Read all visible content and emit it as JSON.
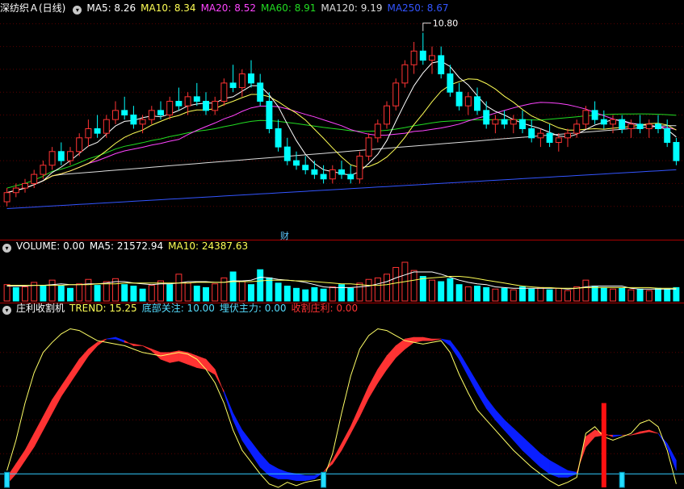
{
  "price_panel": {
    "title": "深纺织Ａ(日线)",
    "ma": [
      {
        "label": "MA5: 8.26",
        "color": "#ffffff"
      },
      {
        "label": "MA10: 8.34",
        "color": "#ffff55"
      },
      {
        "label": "MA20: 8.52",
        "color": "#ff44ff"
      },
      {
        "label": "MA60: 8.91",
        "color": "#22dd22"
      },
      {
        "label": "MA120: 9.19",
        "color": "#dddddd"
      },
      {
        "label": "MA250: 8.67",
        "color": "#3355ff"
      }
    ],
    "high_marker": "10.80",
    "event_marker": "财"
  },
  "volume_panel": {
    "items": [
      {
        "label": "VOLUME: 0.00",
        "color": "#ffffff"
      },
      {
        "label": "MA5: 21572.94",
        "color": "#ffffff"
      },
      {
        "label": "MA10: 24387.63",
        "color": "#ffff55"
      }
    ]
  },
  "indicator_panel": {
    "items": [
      {
        "label": "庄利收割机",
        "color": "#ffffff"
      },
      {
        "label": "TREND: 15.25",
        "color": "#ffff55"
      },
      {
        "label": "底部关注: 10.00",
        "color": "#55ddff"
      },
      {
        "label": "埋伏主力: 0.00",
        "color": "#55ddff"
      },
      {
        "label": "收割庄利: 0.00",
        "color": "#ff3333"
      }
    ]
  },
  "chart_data": [
    {
      "type": "candlestick",
      "ylim": [
        6.5,
        11.2
      ],
      "up_color": "#ff3333",
      "down_color": "#00ffff",
      "candles": [
        [
          7.1,
          7.4,
          7.0,
          7.3
        ],
        [
          7.3,
          7.5,
          7.2,
          7.4
        ],
        [
          7.4,
          7.6,
          7.3,
          7.5
        ],
        [
          7.5,
          7.8,
          7.4,
          7.7
        ],
        [
          7.7,
          8.0,
          7.6,
          7.9
        ],
        [
          7.9,
          8.3,
          7.8,
          8.2
        ],
        [
          8.2,
          8.4,
          7.9,
          8.0
        ],
        [
          8.0,
          8.3,
          7.9,
          8.2
        ],
        [
          8.2,
          8.6,
          8.1,
          8.5
        ],
        [
          8.5,
          8.9,
          8.3,
          8.7
        ],
        [
          8.7,
          9.0,
          8.5,
          8.6
        ],
        [
          8.6,
          9.0,
          8.5,
          8.9
        ],
        [
          8.9,
          9.3,
          8.8,
          9.1
        ],
        [
          9.1,
          9.4,
          8.9,
          9.0
        ],
        [
          9.0,
          9.2,
          8.7,
          8.8
        ],
        [
          8.8,
          9.0,
          8.6,
          8.9
        ],
        [
          8.9,
          9.2,
          8.8,
          9.1
        ],
        [
          9.1,
          9.3,
          8.9,
          9.0
        ],
        [
          9.0,
          9.4,
          8.9,
          9.3
        ],
        [
          9.3,
          9.6,
          9.1,
          9.2
        ],
        [
          9.2,
          9.5,
          9.0,
          9.4
        ],
        [
          9.4,
          9.7,
          9.2,
          9.3
        ],
        [
          9.3,
          9.5,
          9.0,
          9.1
        ],
        [
          9.1,
          9.4,
          9.0,
          9.3
        ],
        [
          9.3,
          9.8,
          9.2,
          9.7
        ],
        [
          9.7,
          10.1,
          9.5,
          9.6
        ],
        [
          9.6,
          10.0,
          9.4,
          9.9
        ],
        [
          9.9,
          10.2,
          9.6,
          9.7
        ],
        [
          9.7,
          9.9,
          9.2,
          9.3
        ],
        [
          9.3,
          9.5,
          8.6,
          8.7
        ],
        [
          8.7,
          8.9,
          8.2,
          8.3
        ],
        [
          8.3,
          8.5,
          7.9,
          8.0
        ],
        [
          8.0,
          8.2,
          7.8,
          7.9
        ],
        [
          7.9,
          8.1,
          7.7,
          7.8
        ],
        [
          7.8,
          8.0,
          7.6,
          7.7
        ],
        [
          7.7,
          7.9,
          7.5,
          7.6
        ],
        [
          7.6,
          7.9,
          7.5,
          7.8
        ],
        [
          7.8,
          8.0,
          7.6,
          7.7
        ],
        [
          7.7,
          7.9,
          7.5,
          7.6
        ],
        [
          7.6,
          8.2,
          7.5,
          8.1
        ],
        [
          8.1,
          8.6,
          8.0,
          8.5
        ],
        [
          8.5,
          8.9,
          8.4,
          8.8
        ],
        [
          8.8,
          9.3,
          8.7,
          9.2
        ],
        [
          9.2,
          9.8,
          9.1,
          9.7
        ],
        [
          9.7,
          10.2,
          9.6,
          10.1
        ],
        [
          10.1,
          10.6,
          9.9,
          10.4
        ],
        [
          10.4,
          10.8,
          10.1,
          10.2
        ],
        [
          10.2,
          10.5,
          9.9,
          10.3
        ],
        [
          10.3,
          10.5,
          9.8,
          9.9
        ],
        [
          9.9,
          10.1,
          9.4,
          9.5
        ],
        [
          9.5,
          9.7,
          9.1,
          9.2
        ],
        [
          9.2,
          9.5,
          9.0,
          9.4
        ],
        [
          9.4,
          9.6,
          9.0,
          9.1
        ],
        [
          9.1,
          9.3,
          8.7,
          8.8
        ],
        [
          8.8,
          9.0,
          8.6,
          8.9
        ],
        [
          8.9,
          9.1,
          8.7,
          8.8
        ],
        [
          8.8,
          9.0,
          8.6,
          8.9
        ],
        [
          8.9,
          9.1,
          8.6,
          8.7
        ],
        [
          8.7,
          8.9,
          8.4,
          8.5
        ],
        [
          8.5,
          8.7,
          8.3,
          8.6
        ],
        [
          8.6,
          8.8,
          8.3,
          8.4
        ],
        [
          8.4,
          8.6,
          8.2,
          8.5
        ],
        [
          8.5,
          8.7,
          8.3,
          8.6
        ],
        [
          8.6,
          8.9,
          8.5,
          8.8
        ],
        [
          8.8,
          9.2,
          8.7,
          9.1
        ],
        [
          9.1,
          9.3,
          8.8,
          8.9
        ],
        [
          8.9,
          9.1,
          8.7,
          8.8
        ],
        [
          8.8,
          9.0,
          8.6,
          8.9
        ],
        [
          8.9,
          9.0,
          8.6,
          8.7
        ],
        [
          8.7,
          8.9,
          8.5,
          8.8
        ],
        [
          8.8,
          9.0,
          8.6,
          8.7
        ],
        [
          8.7,
          8.9,
          8.5,
          8.8
        ],
        [
          8.8,
          9.0,
          8.6,
          8.7
        ],
        [
          8.7,
          8.9,
          8.3,
          8.4
        ],
        [
          8.4,
          8.5,
          7.9,
          8.0
        ]
      ]
    },
    {
      "type": "bar",
      "series_name": "VOLUME",
      "ylim": [
        0,
        6.5
      ],
      "values": [
        2.2,
        1.8,
        1.9,
        2.5,
        2.1,
        2.8,
        2.0,
        1.7,
        2.3,
        2.9,
        2.1,
        2.6,
        3.0,
        2.2,
        2.0,
        1.6,
        2.1,
        2.7,
        2.2,
        3.6,
        2.4,
        2.0,
        1.8,
        2.3,
        3.1,
        3.9,
        2.6,
        2.2,
        4.2,
        3.1,
        2.4,
        2.0,
        1.7,
        1.5,
        1.8,
        1.6,
        1.9,
        2.2,
        1.7,
        2.4,
        2.9,
        3.1,
        3.6,
        4.5,
        5.2,
        4.1,
        3.3,
        2.8,
        2.6,
        3.0,
        2.2,
        1.9,
        2.0,
        1.8,
        1.6,
        1.7,
        1.5,
        1.9,
        1.6,
        1.8,
        1.5,
        1.7,
        1.4,
        1.9,
        2.8,
        2.0,
        1.8,
        1.6,
        1.7,
        1.5,
        1.6,
        1.4,
        1.7,
        1.6,
        1.8
      ],
      "up": [
        1,
        0,
        1,
        1,
        0,
        1,
        0,
        0,
        1,
        1,
        0,
        1,
        1,
        0,
        0,
        0,
        1,
        1,
        0,
        1,
        1,
        0,
        0,
        1,
        1,
        0,
        1,
        0,
        0,
        0,
        0,
        0,
        0,
        0,
        0,
        0,
        1,
        0,
        0,
        1,
        1,
        1,
        1,
        1,
        1,
        1,
        0,
        1,
        0,
        0,
        0,
        1,
        0,
        0,
        1,
        0,
        1,
        0,
        0,
        1,
        0,
        1,
        1,
        1,
        1,
        0,
        0,
        1,
        0,
        1,
        0,
        1,
        0,
        0,
        0
      ],
      "ma5": [
        2.0,
        2.0,
        2.0,
        2.1,
        2.1,
        2.2,
        2.3,
        2.2,
        2.2,
        2.3,
        2.3,
        2.4,
        2.6,
        2.6,
        2.4,
        2.3,
        2.2,
        2.3,
        2.3,
        2.4,
        2.6,
        2.6,
        2.6,
        2.5,
        2.5,
        2.7,
        2.7,
        2.8,
        3.2,
        3.1,
        2.9,
        2.8,
        2.7,
        2.5,
        2.2,
        1.9,
        1.8,
        1.8,
        1.8,
        1.9,
        2.0,
        2.3,
        2.6,
        3.1,
        3.5,
        3.9,
        3.9,
        3.9,
        3.6,
        3.2,
        2.8,
        2.5,
        2.3,
        2.2,
        1.9,
        1.8,
        1.7,
        1.7,
        1.7,
        1.7,
        1.7,
        1.7,
        1.6,
        1.7,
        1.9,
        2.0,
        2.0,
        2.0,
        2.0,
        1.7,
        1.6,
        1.6,
        1.6,
        1.6,
        1.6
      ],
      "ma10": [
        2.1,
        2.1,
        2.1,
        2.1,
        2.1,
        2.1,
        2.1,
        2.2,
        2.2,
        2.2,
        2.3,
        2.3,
        2.3,
        2.4,
        2.4,
        2.4,
        2.4,
        2.4,
        2.4,
        2.4,
        2.4,
        2.5,
        2.5,
        2.5,
        2.5,
        2.6,
        2.6,
        2.6,
        2.7,
        2.8,
        2.8,
        2.8,
        2.7,
        2.7,
        2.6,
        2.5,
        2.4,
        2.3,
        2.3,
        2.2,
        2.1,
        2.1,
        2.2,
        2.4,
        2.6,
        2.8,
        3.0,
        3.1,
        3.2,
        3.3,
        3.3,
        3.2,
        3.0,
        2.8,
        2.6,
        2.4,
        2.2,
        2.0,
        1.9,
        1.8,
        1.8,
        1.7,
        1.7,
        1.7,
        1.8,
        1.8,
        1.8,
        1.8,
        1.8,
        1.8,
        1.8,
        1.8,
        1.7,
        1.7,
        1.7
      ]
    },
    {
      "type": "area",
      "series_name": "TREND",
      "ylim": [
        0,
        100
      ],
      "trend": [
        6,
        14,
        22,
        32,
        42,
        52,
        60,
        68,
        76,
        82,
        86,
        88,
        88,
        86,
        85,
        84,
        82,
        80,
        80,
        81,
        80,
        78,
        76,
        70,
        56,
        40,
        28,
        20,
        12,
        7,
        5,
        5,
        4,
        4,
        5,
        9,
        16,
        26,
        36,
        48,
        60,
        70,
        78,
        84,
        88,
        89,
        89,
        88,
        88,
        84,
        76,
        66,
        56,
        47,
        40,
        34,
        28,
        22,
        17,
        12,
        8,
        6,
        6,
        8,
        30,
        34,
        32,
        30,
        31,
        31,
        33,
        34,
        32,
        24,
        10
      ],
      "signal": [
        2,
        8,
        16,
        24,
        34,
        44,
        54,
        62,
        70,
        78,
        84,
        88,
        89,
        87,
        84,
        84,
        81,
        76,
        74,
        75,
        73,
        71,
        70,
        67,
        57,
        44,
        34,
        27,
        20,
        14,
        11,
        9,
        8,
        7,
        7,
        9,
        14,
        22,
        32,
        42,
        53,
        62,
        70,
        77,
        82,
        86,
        87,
        87,
        88,
        87,
        80,
        71,
        62,
        53,
        46,
        40,
        35,
        30,
        25,
        20,
        16,
        13,
        10,
        9,
        24,
        30,
        31,
        31,
        31,
        31,
        32,
        33,
        32,
        26,
        16
      ],
      "line": [
        10,
        28,
        50,
        68,
        80,
        86,
        91,
        94,
        93,
        90,
        87,
        86,
        85,
        84,
        82,
        80,
        79,
        78,
        79,
        80,
        79,
        76,
        70,
        62,
        50,
        34,
        22,
        15,
        8,
        2,
        0,
        3,
        1,
        3,
        4,
        5,
        20,
        44,
        66,
        82,
        90,
        94,
        93,
        90,
        87,
        86,
        85,
        86,
        87,
        80,
        67,
        56,
        46,
        40,
        34,
        28,
        22,
        17,
        12,
        8,
        4,
        1,
        3,
        6,
        32,
        36,
        30,
        28,
        30,
        32,
        38,
        40,
        36,
        22,
        2
      ],
      "bottom_markers": [
        0,
        35,
        68
      ],
      "harvest_markers": [
        66
      ],
      "baseline": 8
    }
  ]
}
